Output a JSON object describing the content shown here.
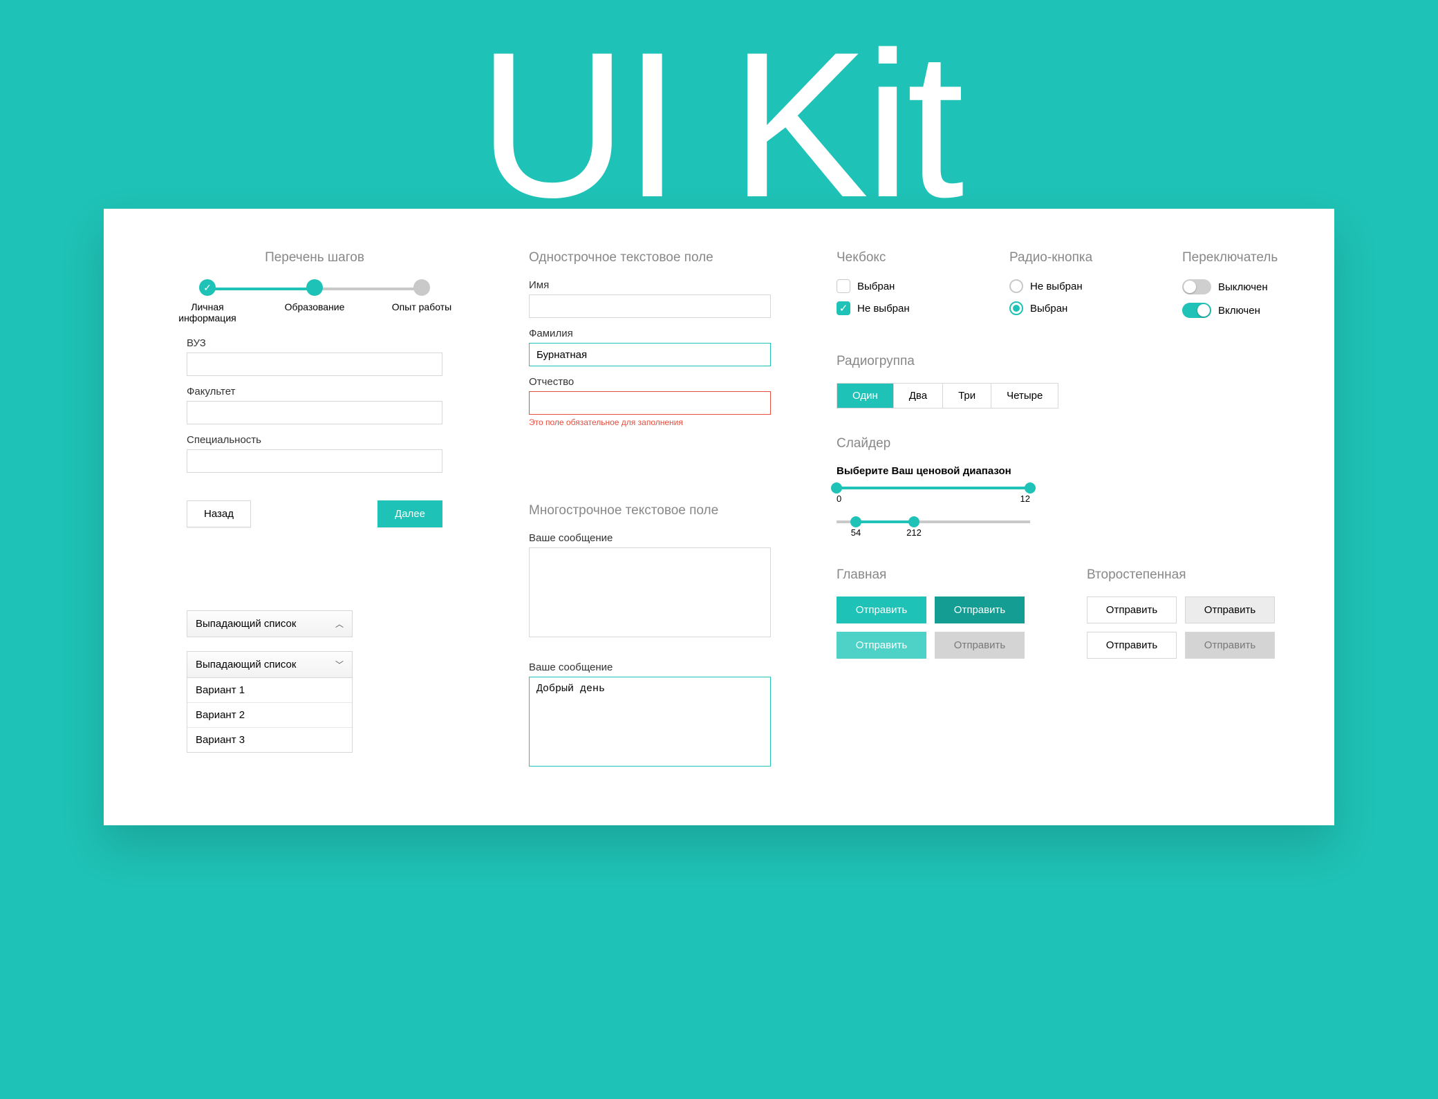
{
  "hero": {
    "title": "UI Kit"
  },
  "stepper": {
    "title": "Перечень шагов",
    "steps": [
      {
        "label": "Личная информация"
      },
      {
        "label": "Образование"
      },
      {
        "label": "Опыт работы"
      }
    ],
    "fields": {
      "vuz_label": "ВУЗ",
      "faculty_label": "Факультет",
      "speciality_label": "Специальность"
    },
    "back_label": "Назад",
    "next_label": "Далее"
  },
  "dropdown": {
    "closed_label": "Выпадающий список",
    "open_label": "Выпадающий список",
    "options": [
      "Вариант 1",
      "Вариант 2",
      "Вариант 3"
    ]
  },
  "text_field": {
    "title": "Однострочное текстовое поле",
    "name_label": "Имя",
    "surname_label": "Фамилия",
    "surname_value": "Бурнатная",
    "patronymic_label": "Отчество",
    "error_msg": "Это поле обязательное для заполнения"
  },
  "textarea": {
    "title": "Многострочное текстовое поле",
    "label": "Ваше сообщение",
    "value2": "Добрый день"
  },
  "checkbox": {
    "title": "Чекбокс",
    "selected_label": "Выбран",
    "unselected_label": "Не выбран"
  },
  "radio": {
    "title": "Радио-кнопка",
    "unselected_label": "Не выбран",
    "selected_label": "Выбран"
  },
  "switch": {
    "title": "Переключатель",
    "off_label": "Выключен",
    "on_label": "Включен"
  },
  "radiogroup": {
    "title": "Радиогруппа",
    "options": [
      "Один",
      "Два",
      "Три",
      "Четыре"
    ]
  },
  "slider": {
    "title": "Слайдер",
    "label": "Выберите Ваш ценовой диапазон",
    "range1": {
      "min": "0",
      "max": "12"
    },
    "range2": {
      "a": "54",
      "b": "212"
    }
  },
  "buttons": {
    "primary_title": "Главная",
    "secondary_title": "Второстепенная",
    "send_label": "Отправить"
  }
}
